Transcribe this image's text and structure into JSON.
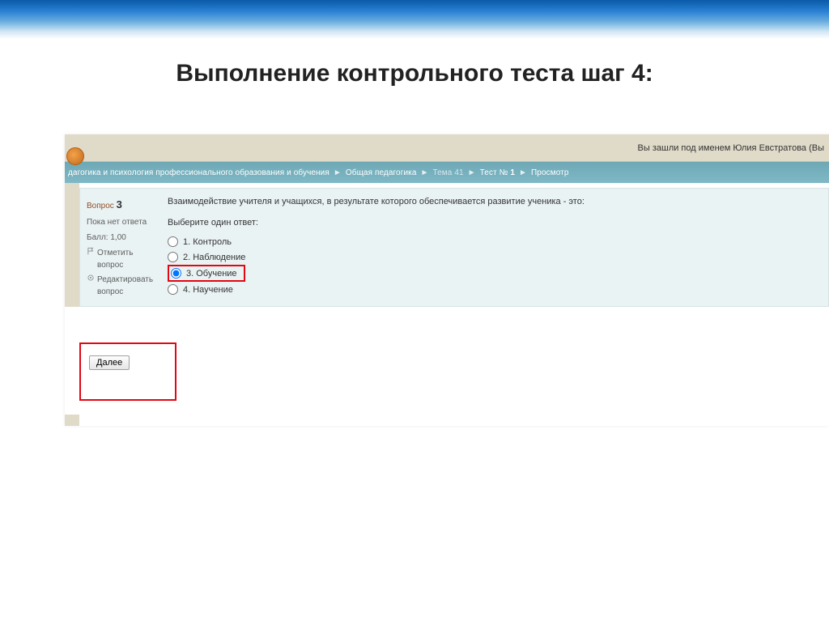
{
  "slide": {
    "title": "Выполнение контрольного теста шаг 4:"
  },
  "userbar": {
    "text": "Вы зашли под именем Юлия Евстратова (Вы"
  },
  "breadcrumb": {
    "item0": "дагогика и психология профессионального образования и обучения",
    "item1": "Общая педагогика",
    "item2": "Тема 41",
    "item3_pre": "Тест №",
    "item3_num": "1",
    "item4": "Просмотр"
  },
  "question": {
    "label": "Вопрос",
    "number": "3",
    "status": "Пока нет ответа",
    "score": "Балл: 1,00",
    "flag": "Отметить вопрос",
    "edit": "Редактировать вопрос",
    "text": "Взаимодействие учителя и учащихся, в результате которого обеспечивается развитие ученика -  это:",
    "hint": "Выберите один ответ:",
    "answers": {
      "a1": "1. Контроль",
      "a2": "2. Наблюдение",
      "a3": "3. Обучение",
      "a4": "4. Научение"
    },
    "selected": 3
  },
  "buttons": {
    "next": "Далее"
  }
}
